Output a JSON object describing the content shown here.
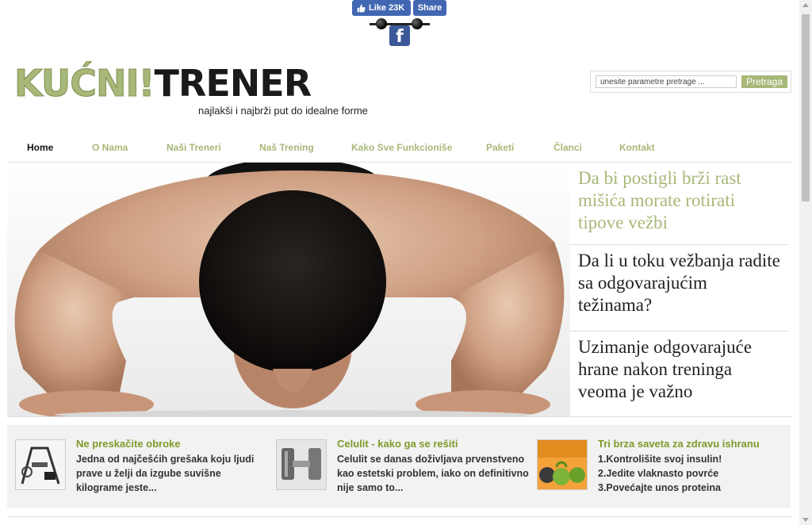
{
  "facebook": {
    "like_label": "Like 23K",
    "share_label": "Share",
    "logo_glyph": "f",
    "brand_color": "#4267b2"
  },
  "logo": {
    "part1": "KUĆNI!",
    "part2": "TRENER",
    "tagline": "najlakši i najbrži put do idealne forme",
    "accent_color": "#a8b878"
  },
  "search": {
    "placeholder": "unesite parametre pretrage ...",
    "button_label": "Pretraga"
  },
  "nav": {
    "items": [
      {
        "label": "Home",
        "active": true
      },
      {
        "label": "O Nama"
      },
      {
        "label": "Naši Treneri"
      },
      {
        "label": "Naš Trening"
      },
      {
        "label": "Kako Sve Funkcioniše"
      },
      {
        "label": "Paketi"
      },
      {
        "label": "Članci"
      },
      {
        "label": "Kontakt"
      }
    ]
  },
  "hero": {
    "image": "man-doing-pushups-photo"
  },
  "side_articles": [
    {
      "title": "Da bi postigli brži rast mišića morate rotirati tipove vežbi",
      "highlighted": true
    },
    {
      "title": "Da li u toku vežbanja radite sa odgovarajućim težinama?"
    },
    {
      "title": "Uzimanje odgovarajuće hrane nakon treninga veoma je važno"
    }
  ],
  "teasers": [
    {
      "title": "Ne preskačite obroke",
      "text": "Jedna od najčešćih grešaka koju ljudi prave u želji da izgube suvišne kilograme jeste...",
      "thumb": "gym-machine-thumb"
    },
    {
      "title": "Celulit - kako ga se rešiti",
      "text": "Celulit se danas doživljava prvenstveno kao estetski problem, iako on definitivno nije samo to...",
      "thumb": "dumbbell-thumb"
    },
    {
      "title": "Tri brza saveta za zdravu ishranu",
      "text": "1.Kontrolišite svoj insulin!\n2.Jedite vlaknasto povrće\n3.Povećajte unos proteina",
      "thumb": "kettlebells-thumb"
    }
  ]
}
